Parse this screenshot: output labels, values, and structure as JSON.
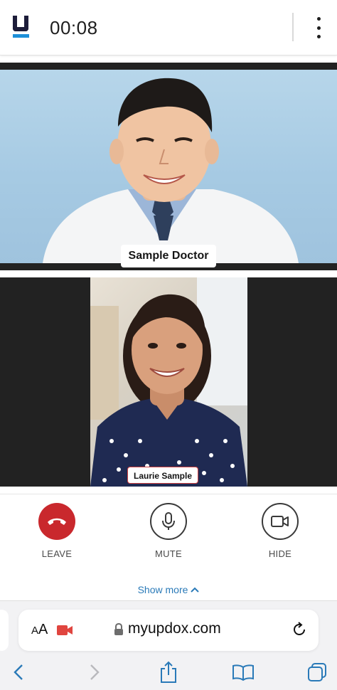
{
  "header": {
    "timer": "00:08"
  },
  "participants": {
    "doctor": {
      "name": "Sample Doctor"
    },
    "patient": {
      "name": "Laurie Sample"
    }
  },
  "controls": {
    "leave_label": "LEAVE",
    "mute_label": "MUTE",
    "hide_label": "HIDE",
    "show_more_label": "Show more"
  },
  "browser": {
    "text_size_label_small": "A",
    "text_size_label_large": "A",
    "url": "myupdox.com"
  },
  "colors": {
    "leave": "#c9282d",
    "link": "#2a7ab8",
    "brand_dark": "#1d1d3a",
    "brand_blue": "#1d8fd8",
    "recording": "#e0453f"
  }
}
